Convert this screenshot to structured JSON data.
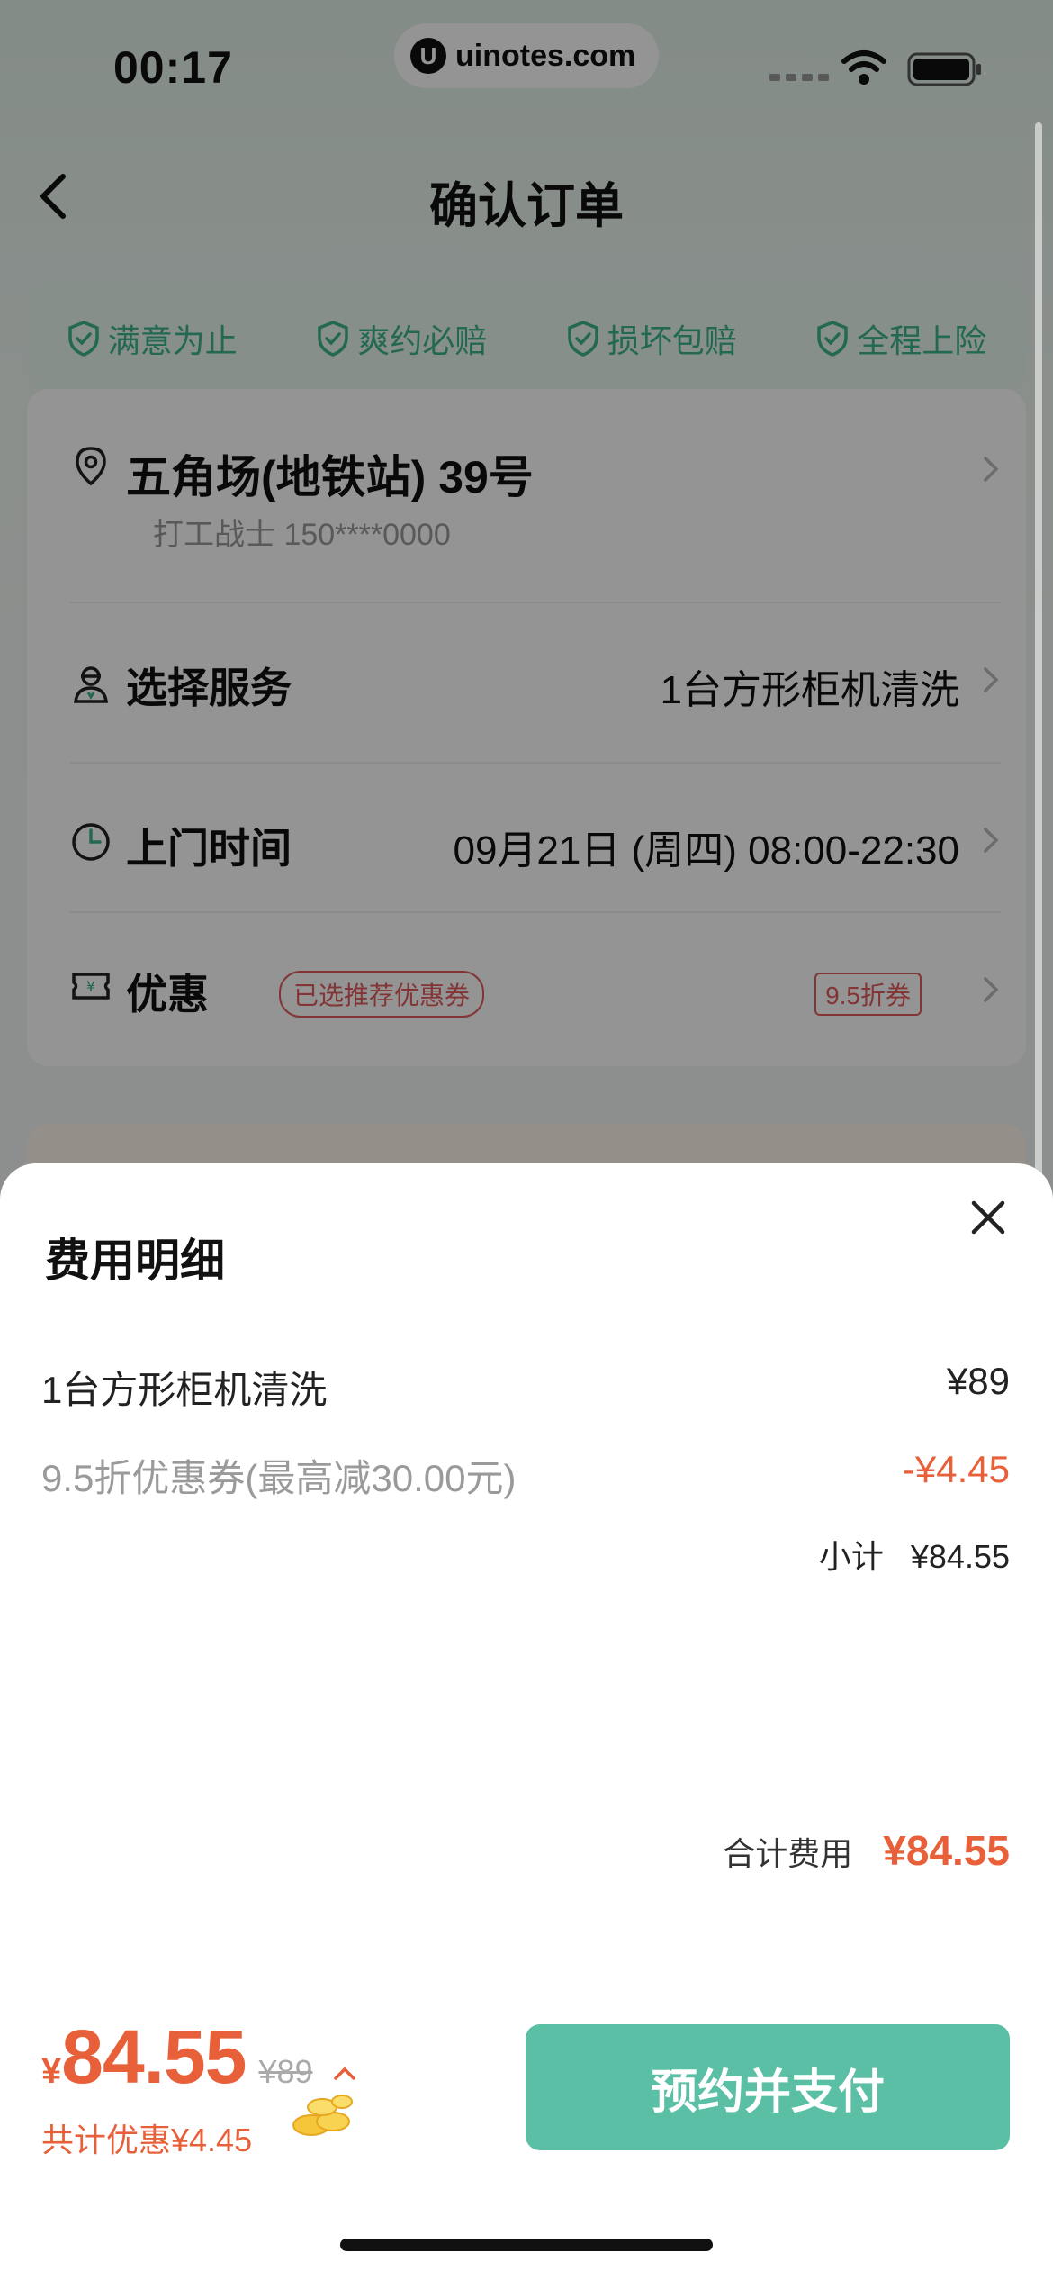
{
  "status_bar": {
    "time": "00:17",
    "watermark": "uinotes.com"
  },
  "nav": {
    "title": "确认订单"
  },
  "guarantees": [
    "满意为止",
    "爽约必赔",
    "损坏包赔",
    "全程上险"
  ],
  "order": {
    "address": {
      "title": "五角场(地铁站) 39号",
      "contact": "打工战士 150****0000"
    },
    "service": {
      "label": "选择服务",
      "value": "1台方形柜机清洗"
    },
    "time": {
      "label": "上门时间",
      "value": "09月21日 (周四) 08:00-22:30"
    },
    "discount": {
      "label": "优惠",
      "tag": "已选推荐优惠券",
      "coupon": "9.5折券"
    }
  },
  "sheet": {
    "title": "费用明细",
    "items": [
      {
        "name": "1台方形柜机清洗",
        "amount": "¥89"
      },
      {
        "name": "9.5折优惠券(最高减30.00元)",
        "amount": "-¥4.45"
      }
    ],
    "subtotal_label": "小计",
    "subtotal_value": "¥84.55",
    "total_label": "合计费用",
    "total_value": "¥84.55"
  },
  "pay_bar": {
    "currency": "¥",
    "price": "84.55",
    "original_price": "¥89",
    "discount_text": "共计优惠¥4.45",
    "button_label": "预约并支付"
  },
  "colors": {
    "accent": "#5bbfa6",
    "price": "#e8603a",
    "tag_red": "#e25a5a",
    "guarantee_green": "#3db38c"
  }
}
